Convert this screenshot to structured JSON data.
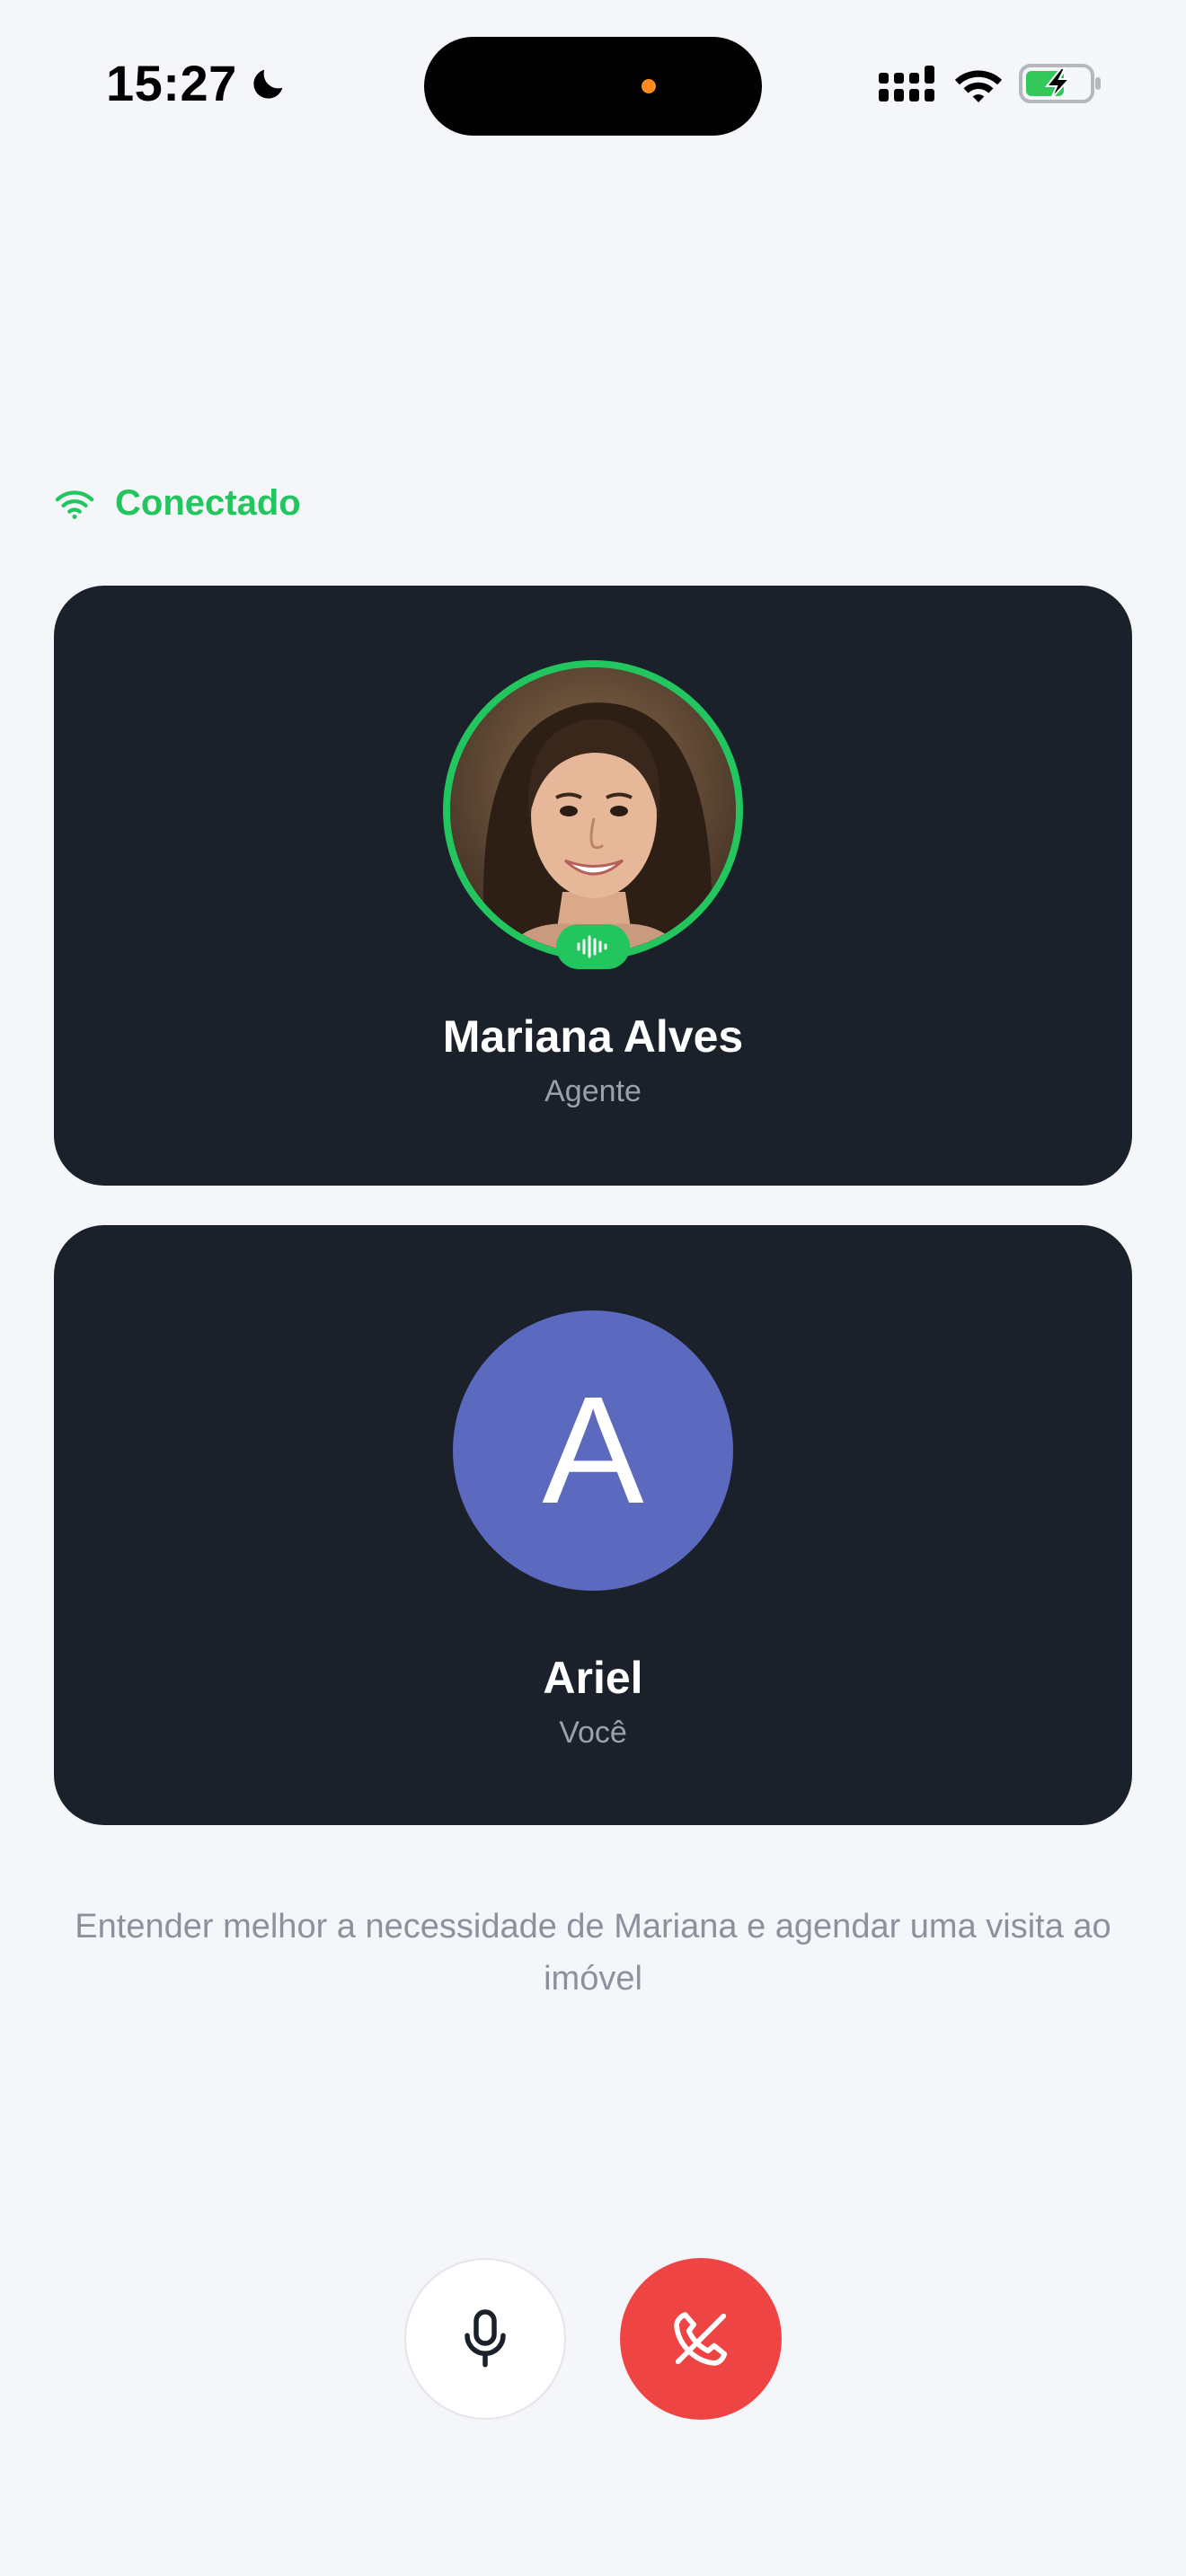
{
  "status_bar": {
    "time": "15:27",
    "icons": [
      "moon-icon",
      "cellular-signal-icon",
      "wifi-icon",
      "battery-charging-icon"
    ],
    "indicator_color": "#ff8a1f"
  },
  "connection": {
    "label": "Conectado",
    "icon": "wifi-icon",
    "color": "#22c55e"
  },
  "participants": {
    "agent": {
      "name": "Mariana Alves",
      "role": "Agente",
      "speaking": true,
      "ring_color": "#22c55e",
      "badge_icon": "audio-waveform-icon"
    },
    "user": {
      "name": "Ariel",
      "role": "Você",
      "initial": "A",
      "avatar_color": "#5b69bf"
    }
  },
  "call_goal": "Entender melhor a necessidade de Mariana e agendar uma visita ao imóvel",
  "controls": {
    "mic_icon": "microphone-icon",
    "end_icon": "phone-hangup-icon",
    "end_color": "#ef4444"
  }
}
